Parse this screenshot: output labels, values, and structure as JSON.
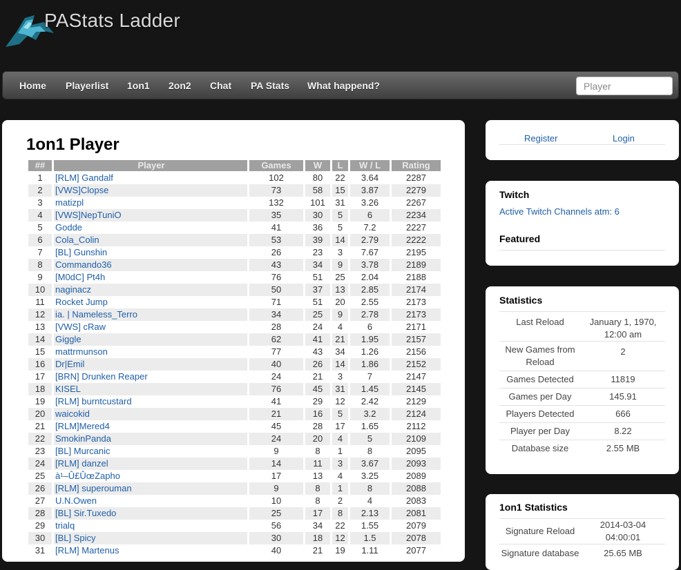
{
  "header": {
    "title": "PAStats Ladder",
    "logo_icon": "pa-logo-icon"
  },
  "nav": {
    "items": [
      "Home",
      "Playerlist",
      "1on1",
      "2on2",
      "Chat",
      "PA Stats",
      "What happend?"
    ],
    "search_placeholder": "Player"
  },
  "main": {
    "title": "1on1 Player",
    "columns": [
      "##",
      "Player",
      "Games",
      "W",
      "L",
      "W / L",
      "Rating"
    ],
    "rows": [
      [
        "1",
        "[RLM] Gandalf",
        "102",
        "80",
        "22",
        "3.64",
        "2287"
      ],
      [
        "2",
        "[VWS]Clopse",
        "73",
        "58",
        "15",
        "3.87",
        "2279"
      ],
      [
        "3",
        "matizpl",
        "132",
        "101",
        "31",
        "3.26",
        "2267"
      ],
      [
        "4",
        "[VWS]NepTuniO",
        "35",
        "30",
        "5",
        "6",
        "2234"
      ],
      [
        "5",
        "Godde",
        "41",
        "36",
        "5",
        "7.2",
        "2227"
      ],
      [
        "6",
        "Cola_Colin",
        "53",
        "39",
        "14",
        "2.79",
        "2222"
      ],
      [
        "7",
        "[BL] Gunshin",
        "26",
        "23",
        "3",
        "7.67",
        "2195"
      ],
      [
        "8",
        "Commando36",
        "43",
        "34",
        "9",
        "3.78",
        "2189"
      ],
      [
        "9",
        "[M0dC] Pt4h",
        "76",
        "51",
        "25",
        "2.04",
        "2188"
      ],
      [
        "10",
        "naginacz",
        "50",
        "37",
        "13",
        "2.85",
        "2174"
      ],
      [
        "11",
        "Rocket Jump",
        "71",
        "51",
        "20",
        "2.55",
        "2173"
      ],
      [
        "12",
        "ia. | Nameless_Terro",
        "34",
        "25",
        "9",
        "2.78",
        "2173"
      ],
      [
        "13",
        "[VWS] cRaw",
        "28",
        "24",
        "4",
        "6",
        "2171"
      ],
      [
        "14",
        "Giggle",
        "62",
        "41",
        "21",
        "1.95",
        "2157"
      ],
      [
        "15",
        "mattrmunson",
        "77",
        "43",
        "34",
        "1.26",
        "2156"
      ],
      [
        "16",
        "Dr|Emil",
        "40",
        "26",
        "14",
        "1.86",
        "2152"
      ],
      [
        "17",
        "[BRN] Drunken Reaper",
        "24",
        "21",
        "3",
        "7",
        "2147"
      ],
      [
        "18",
        "KISEL",
        "76",
        "45",
        "31",
        "1.45",
        "2145"
      ],
      [
        "19",
        "[RLM] burntcustard",
        "41",
        "29",
        "12",
        "2.42",
        "2129"
      ],
      [
        "20",
        "waicokid",
        "21",
        "16",
        "5",
        "3.2",
        "2124"
      ],
      [
        "21",
        "[RLM]Mered4",
        "45",
        "28",
        "17",
        "1.65",
        "2112"
      ],
      [
        "22",
        "SmokinPanda",
        "24",
        "20",
        "4",
        "5",
        "2109"
      ],
      [
        "23",
        "[BL] Murcanic",
        "9",
        "8",
        "1",
        "8",
        "2095"
      ],
      [
        "24",
        "[RLM] danzel",
        "14",
        "11",
        "3",
        "3.67",
        "2093"
      ],
      [
        "25",
        "à¹–Û£ÛœZapho",
        "17",
        "13",
        "4",
        "3.25",
        "2089"
      ],
      [
        "26",
        "[RLM] superouman",
        "9",
        "8",
        "1",
        "8",
        "2088"
      ],
      [
        "27",
        "U.N.Owen",
        "10",
        "8",
        "2",
        "4",
        "2083"
      ],
      [
        "28",
        "[BL] Sir.Tuxedo",
        "25",
        "17",
        "8",
        "2.13",
        "2081"
      ],
      [
        "29",
        "trialq",
        "56",
        "34",
        "22",
        "1.55",
        "2079"
      ],
      [
        "30",
        "[BL] Spicy",
        "30",
        "18",
        "12",
        "1.5",
        "2078"
      ],
      [
        "31",
        "[RLM] Martenus",
        "40",
        "21",
        "19",
        "1.11",
        "2077"
      ]
    ]
  },
  "sidebar": {
    "auth": {
      "register": "Register",
      "login": "Login"
    },
    "twitch": {
      "title": "Twitch",
      "link": "Active Twitch Channels atm: 6",
      "featured": "Featured"
    },
    "stats": {
      "title": "Statistics",
      "rows": [
        [
          "Last Reload",
          "January 1, 1970, 12:00 am"
        ],
        [
          "New Games from Reload",
          "2"
        ],
        [
          "Games Detected",
          "11819"
        ],
        [
          "Games per Day",
          "145.91"
        ],
        [
          "Players Detected",
          "666"
        ],
        [
          "Player per Day",
          "8.22"
        ],
        [
          "Database size",
          "2.55 MB"
        ]
      ]
    },
    "stats1v1": {
      "title": "1on1 Statistics",
      "rows": [
        [
          "Signature Reload",
          "2014-03-04 04:00:01"
        ],
        [
          "Signature database",
          "25.65 MB"
        ]
      ]
    }
  }
}
